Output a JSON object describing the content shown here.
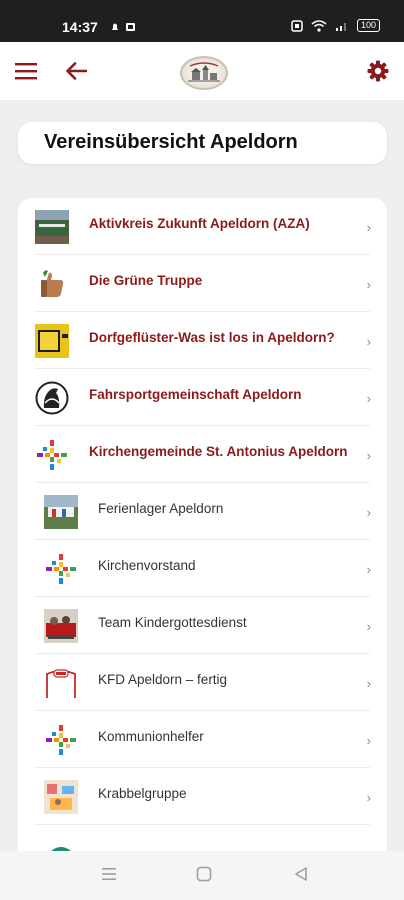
{
  "status_bar": {
    "time": "14:37",
    "battery": "100"
  },
  "page_title": "Vereinsübersicht Apeldorn",
  "clubs": [
    {
      "label": "Aktivkreis Zukunft Apeldorn (AZA)",
      "level": "top",
      "icon": "aza-thumbnail"
    },
    {
      "label": "Die Grüne Truppe",
      "level": "top",
      "icon": "thumbs-up-icon"
    },
    {
      "label": "Dorfgeflüster-Was ist los in Apeldorn?",
      "level": "top",
      "icon": "dorfgefluester-thumbnail"
    },
    {
      "label": "Fahrsportgemeinschaft Apeldorn",
      "level": "top",
      "icon": "horse-logo-icon"
    },
    {
      "label": "Kirchengemeinde St. Antonius Apeldorn",
      "level": "top",
      "icon": "colorful-cross-icon"
    },
    {
      "label": "Ferienlager Apeldorn",
      "level": "sub",
      "icon": "ferienlager-thumbnail"
    },
    {
      "label": "Kirchenvorstand",
      "level": "sub",
      "icon": "colorful-cross-icon"
    },
    {
      "label": "Team Kindergottesdienst",
      "level": "sub",
      "icon": "kindergottesdienst-thumbnail"
    },
    {
      "label": "KFD Apeldorn – fertig",
      "level": "sub",
      "icon": "kfd-logo-icon"
    },
    {
      "label": "Kommunionhelfer",
      "level": "sub",
      "icon": "colorful-cross-icon"
    },
    {
      "label": "Krabbelgruppe",
      "level": "sub",
      "icon": "krabbelgruppe-thumbnail"
    }
  ],
  "colors": {
    "accent": "#8b1a1a",
    "background": "#efefef",
    "card": "#ffffff"
  }
}
